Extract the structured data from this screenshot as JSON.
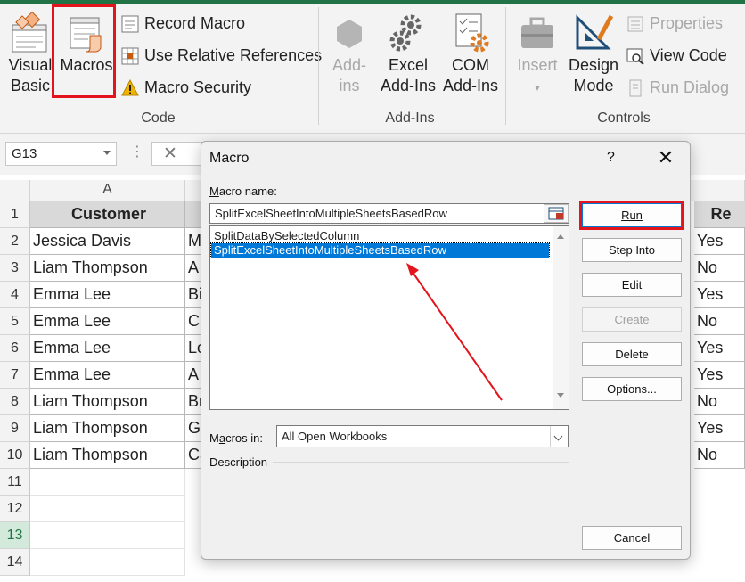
{
  "ribbon": {
    "code": {
      "group_label": "Code",
      "visual_basic": [
        "Visual",
        "Basic"
      ],
      "macros": "Macros",
      "record_macro": "Record Macro",
      "use_relative": "Use Relative References",
      "macro_security": "Macro Security"
    },
    "addins": {
      "group_label": "Add-Ins",
      "addins": [
        "Add-",
        "ins"
      ],
      "excel_addins": [
        "Excel",
        "Add-Ins"
      ],
      "com_addins": [
        "COM",
        "Add-Ins"
      ]
    },
    "controls": {
      "group_label": "Controls",
      "insert": "Insert",
      "design_mode": [
        "Design",
        "Mode"
      ],
      "properties": "Properties",
      "view_code": "View Code",
      "run_dialog": "Run Dialog"
    }
  },
  "formula_bar": {
    "name_box": "G13",
    "cancel": "✕"
  },
  "sheet": {
    "col_a": "A",
    "header": {
      "customer": "Customer",
      "partial_right": "Re"
    },
    "row_numbers": [
      "1",
      "2",
      "3",
      "4",
      "5",
      "6",
      "7",
      "8",
      "9",
      "10",
      "11",
      "12",
      "13",
      "14"
    ],
    "rows": [
      {
        "name": "Jessica Davis",
        "b": "M",
        "r": "Yes"
      },
      {
        "name": "Liam Thompson",
        "b": "A",
        "r": "No"
      },
      {
        "name": "Emma Lee",
        "b": "Bi",
        "r": "Yes"
      },
      {
        "name": "Emma Lee",
        "b": "Cl",
        "r": "No"
      },
      {
        "name": "Emma Lee",
        "b": "Lo",
        "r": "Yes"
      },
      {
        "name": "Emma Lee",
        "b": "A",
        "r": "Yes"
      },
      {
        "name": "Liam Thompson",
        "b": "Br",
        "r": "No"
      },
      {
        "name": "Liam Thompson",
        "b": "G",
        "r": "Yes"
      },
      {
        "name": "Liam Thompson",
        "b": "Ca",
        "r": "No"
      }
    ]
  },
  "dialog": {
    "title": "Macro",
    "help": "?",
    "close": "✕",
    "macro_name_label": "Macro name:",
    "macro_name_value": "SplitExcelSheetIntoMultipleSheetsBasedRow",
    "macros": [
      "SplitDataBySelectedColumn",
      "SplitExcelSheetIntoMultipleSheetsBasedRow"
    ],
    "macros_in_label": "Macros in:",
    "macros_in_value": "All Open Workbooks",
    "description_label": "Description",
    "buttons": {
      "run": "Run",
      "step_into": "Step Into",
      "edit": "Edit",
      "create": "Create",
      "delete": "Delete",
      "options": "Options...",
      "cancel": "Cancel"
    }
  },
  "colors": {
    "highlight": "#e3141b",
    "selection": "#0078d7",
    "excel_green": "#217346"
  }
}
